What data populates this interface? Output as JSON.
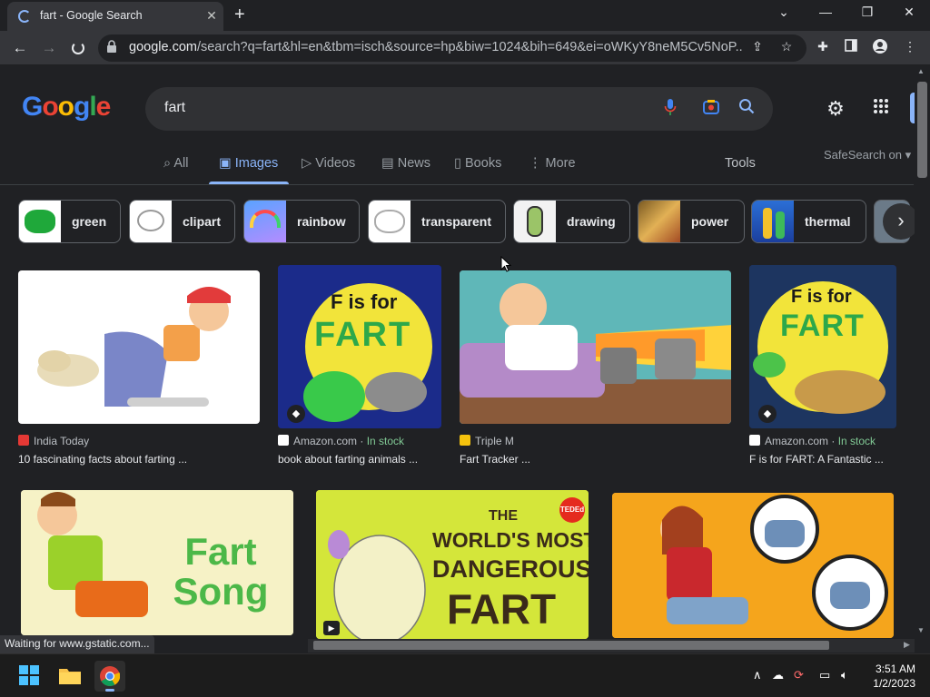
{
  "browser": {
    "tab_title": "fart - Google Search",
    "url_domain": "google.com",
    "url_path": "/search?q=fart&hl=en&tbm=isch&source=hp&biw=1024&bih=649&ei=oWKyY8neM5Cv5NoP...",
    "status_text": "Waiting for www.gstatic.com..."
  },
  "google": {
    "logo_text": "Google",
    "query": "fart",
    "tabs": [
      {
        "label": "All",
        "icon": "search-icon"
      },
      {
        "label": "Images",
        "icon": "image-icon"
      },
      {
        "label": "Videos",
        "icon": "play-icon"
      },
      {
        "label": "News",
        "icon": "news-icon"
      },
      {
        "label": "Books",
        "icon": "book-icon"
      },
      {
        "label": "More",
        "icon": "more-vert-icon"
      }
    ],
    "tools_label": "Tools",
    "safesearch_label": "SafeSearch on"
  },
  "chips": [
    {
      "label": "green",
      "color": "#1fa83a"
    },
    {
      "label": "clipart",
      "color": "#f1f1f1"
    },
    {
      "label": "rainbow",
      "color": "#6aa0ff"
    },
    {
      "label": "transparent",
      "color": "#f5f5f5"
    },
    {
      "label": "drawing",
      "color": "#e6e6e6"
    },
    {
      "label": "power",
      "color": "#c69a3c"
    },
    {
      "label": "thermal",
      "color": "#2b6fd6"
    }
  ],
  "results": [
    {
      "source": "India Today",
      "title": "10 fascinating facts about farting ...",
      "stock": "",
      "fav_color": "#e53935"
    },
    {
      "source": "Amazon.com",
      "title": "book about farting animals ...",
      "stock": "In stock",
      "fav_color": "#ffffff"
    },
    {
      "source": "Triple M",
      "title": "Fart Tracker ...",
      "stock": "",
      "fav_color": "#f4c20d"
    },
    {
      "source": "Amazon.com",
      "title": "F is for FART: A Fantastic ...",
      "stock": "In stock",
      "fav_color": "#ffffff"
    }
  ],
  "image_text": {
    "book1_line1": "F is for",
    "book1_line2": "FART",
    "book2_line1": "F is for",
    "book2_line2": "FART",
    "song_text": "Fart Song",
    "ted_badge": "TEDEd",
    "ted_line1": "THE",
    "ted_line2": "WORLD'S MOST",
    "ted_line3": "DANGEROUS",
    "ted_line4": "FART"
  },
  "taskbar": {
    "time": "3:51 AM",
    "date": "1/2/2023"
  },
  "colors": {
    "page_bg": "#202124",
    "link_blue": "#8ab4f8",
    "in_stock_green": "#81c995"
  }
}
